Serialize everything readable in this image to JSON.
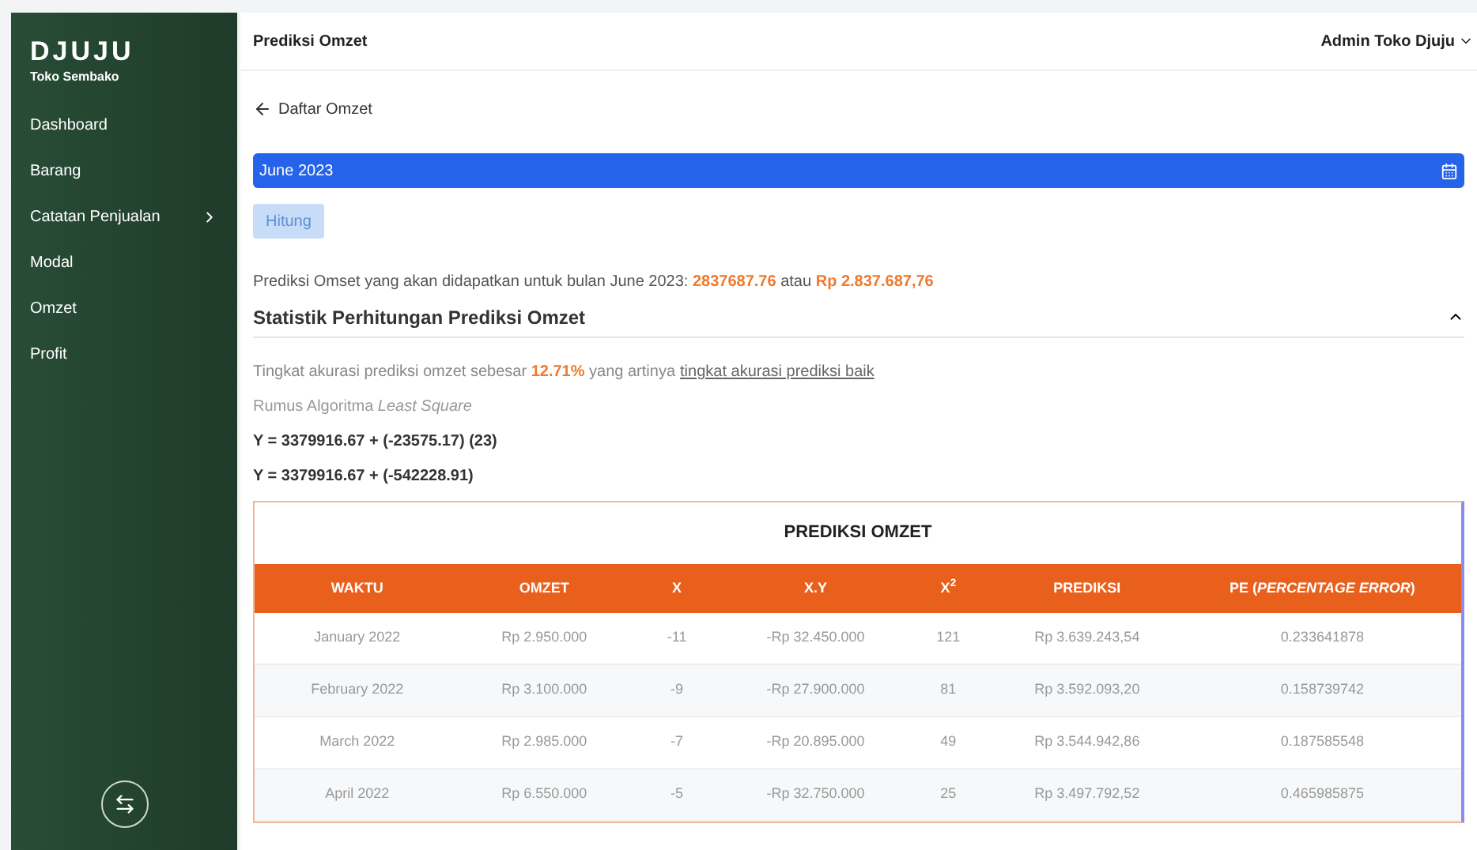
{
  "sidebar": {
    "brand": "DJUJU",
    "subtitle": "Toko Sembako",
    "items": [
      {
        "label": "Dashboard",
        "kind": "link"
      },
      {
        "label": "Barang",
        "kind": "link"
      },
      {
        "label": "Catatan Penjualan",
        "kind": "submenu"
      },
      {
        "label": "Modal",
        "kind": "link"
      },
      {
        "label": "Omzet",
        "kind": "link"
      },
      {
        "label": "Profit",
        "kind": "link"
      }
    ]
  },
  "header": {
    "title": "Prediksi Omzet",
    "user": "Admin Toko Djuju"
  },
  "back_link": "Daftar Omzet",
  "month_field": {
    "value": "June 2023"
  },
  "calculate_button": "Hitung",
  "prediction": {
    "text": "Prediksi Omset yang akan didapatkan untuk bulan June 2023: ",
    "value": "2837687.76",
    "joiner": " atau ",
    "value_rp": "Rp 2.837.687,76"
  },
  "statistics": {
    "title": "Statistik Perhitungan Prediksi Omzet",
    "expanded": true,
    "accuracy": {
      "before": "Tingkat akurasi prediksi omzet sebesar ",
      "percent": "12.71%",
      "middle": " yang artinya",
      "link": "tingkat akurasi prediksi baik"
    },
    "formula_label": "Rumus Algoritma *Least Square*",
    "equations": [
      "Y = 3379916.67 + (-23575.17) (23)",
      "Y = 3379916.67 + (-542228.91)"
    ]
  },
  "table": {
    "title": "PREDIKSI OMZET",
    "columns": [
      "WAKTU",
      "OMZET",
      "X",
      "X.Y",
      "X$^{2}$",
      "PREDIKSI",
      "PE (*PERCENTAGE ERROR*)"
    ],
    "rows": [
      [
        "January 2022",
        "Rp 2.950.000",
        "-11",
        "-Rp 32.450.000",
        "121",
        "Rp 3.639.243,54",
        "0.233641878"
      ],
      [
        "February 2022",
        "Rp 3.100.000",
        "-9",
        "-Rp 27.900.000",
        "81",
        "Rp 3.592.093,20",
        "0.158739742"
      ],
      [
        "March 2022",
        "Rp 2.985.000",
        "-7",
        "-Rp 20.895.000",
        "49",
        "Rp 3.544.942,86",
        "0.187585548"
      ],
      [
        "April 2022",
        "Rp 6.550.000",
        "-5",
        "-Rp 32.750.000",
        "25",
        "Rp 3.497.792,52",
        "0.465985875"
      ]
    ]
  }
}
